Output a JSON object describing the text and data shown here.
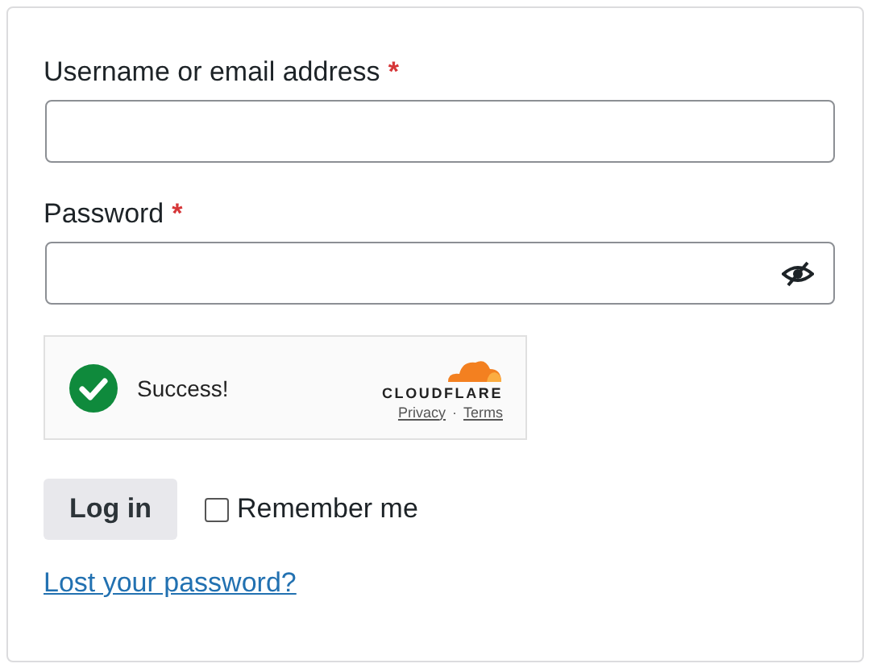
{
  "fields": [
    {
      "label": "Username or email address",
      "required_mark": "*",
      "kind": "text"
    },
    {
      "label": "Password",
      "required_mark": "*",
      "kind": "password"
    }
  ],
  "captcha": {
    "status": "Success!",
    "brand": "CLOUDFLARE",
    "links": [
      "Privacy",
      "Terms"
    ],
    "separator": "·"
  },
  "login_button": "Log in",
  "remember": {
    "label": "Remember me",
    "checked": false
  },
  "lost_password": "Lost your password?"
}
